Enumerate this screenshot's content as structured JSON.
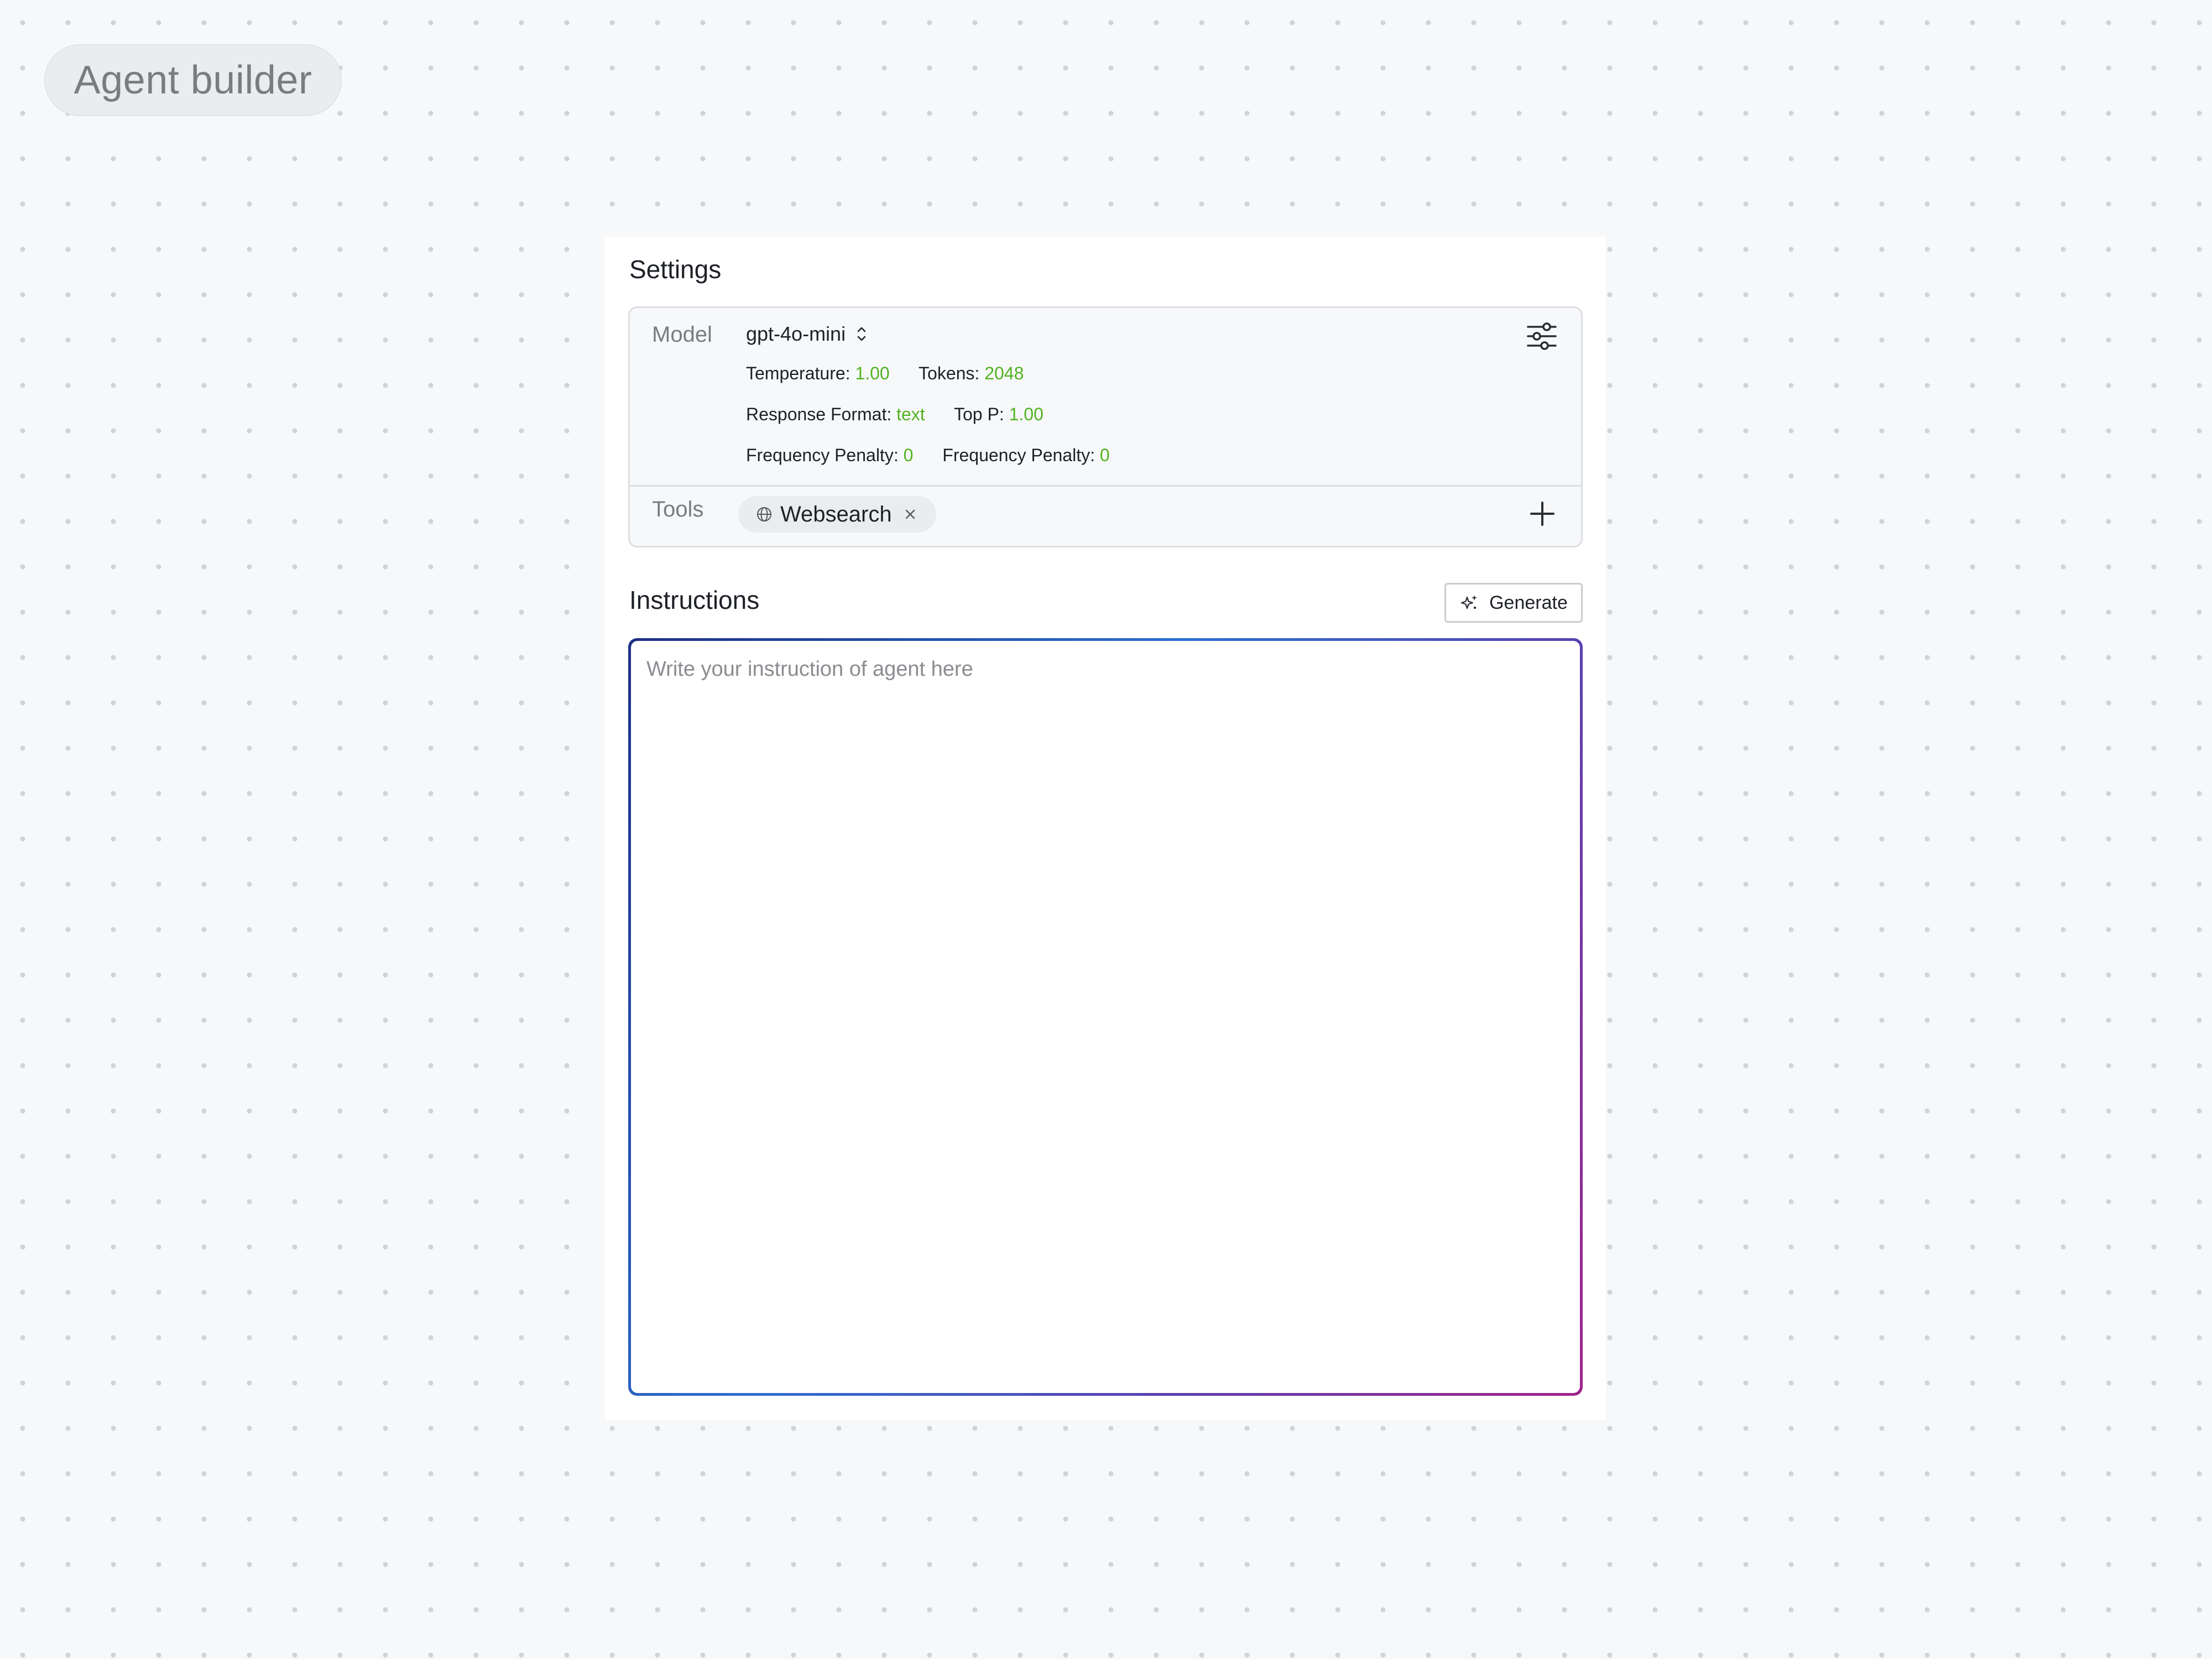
{
  "app": {
    "title": "Agent builder"
  },
  "settings": {
    "title": "Settings",
    "model": {
      "label": "Model",
      "selected": "gpt-4o-mini",
      "params_row1": [
        {
          "label": "Temperature:",
          "value": "1.00"
        },
        {
          "label": "Tokens:",
          "value": "2048"
        }
      ],
      "params_row2": [
        {
          "label": "Response Format:",
          "value": "text"
        },
        {
          "label": "Top P:",
          "value": "1.00"
        }
      ],
      "params_row3": [
        {
          "label": "Frequency Penalty:",
          "value": "0"
        },
        {
          "label": "Frequency Penalty:",
          "value": "0"
        }
      ]
    },
    "tools": {
      "label": "Tools",
      "items": [
        {
          "label": "Websearch",
          "icon": "globe-icon"
        }
      ]
    }
  },
  "instructions": {
    "title": "Instructions",
    "generate_label": "Generate",
    "placeholder": "Write your instruction of agent here",
    "value": ""
  },
  "colors": {
    "value_green": "#52b321",
    "accent_blue": "#2b6fd0",
    "accent_purple": "#a2228a"
  }
}
